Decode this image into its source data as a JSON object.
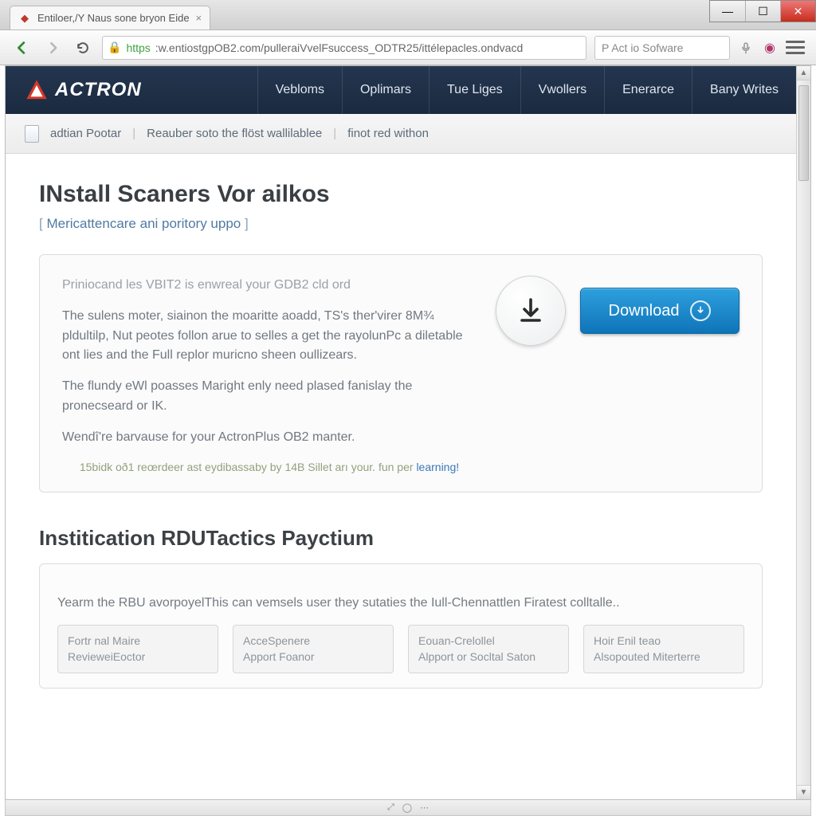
{
  "browser": {
    "tab_title": "Entiloer,/Y Naus sone bryon Eide",
    "url_proto": "https",
    "url_rest": ":w.entiostgpOB2.com/pulleraiVvelFsuccess_ODTR25/ittélepacles.ondvacd",
    "search_placeholder": "P Act io Sofware"
  },
  "header": {
    "brand": "ACTRON",
    "nav": [
      "Vebloms",
      "Oplimars",
      "Tue Liges",
      "Vwollers",
      "Enerarce",
      "Bany Writes"
    ]
  },
  "infobar": {
    "a": "adtian Pootar",
    "b": "Reauber soto the flöst wallilablee",
    "c": "finot red withon"
  },
  "main": {
    "title": "INstall Scaners Vor ailkos",
    "subtitle": "Mericattencare ani poritory uppo",
    "panel": {
      "lead": "Priniocand les VBIT2 is enwreal your GDB2 cld ord",
      "p1": "The sulens moter, siainon the moaritte aoadd, TS's ther'virer 8M¾ pldultilp, Nut peotes follon arue to selles a get the rayolunPc a diletable ont lies and the Full replor muricno sheen oullizears.",
      "p2": "The flundy eWl poasses Maright enly need plased fanislay the pronecseard or IK.",
      "p3": "Wendî're barvause for your ActronPlus OB2 manter.",
      "footnote_a": "15bidk oð1 reœrdeer ast eydibassaby by 14B Sillet arı your. fun per",
      "footnote_link": "learning!"
    },
    "download_label": "Download",
    "section2_title": "Institication RDUTactics Payctium",
    "section2_note": "Yearm the RBU avorpoyelThis can vemsels user they sutaties the Iull-Chennattlen Firatest colltalle..",
    "cards": [
      {
        "l1": "Fortr nal Maire",
        "l2": "RevieweiEoctor"
      },
      {
        "l1": "AcceSpenere",
        "l2": "Apport Foanor"
      },
      {
        "l1": "Eouan-Crelollel",
        "l2": "Alpport or Socltal Saton"
      },
      {
        "l1": "Hoir Enil teao",
        "l2": "Alsopouted Miterterre"
      }
    ]
  }
}
